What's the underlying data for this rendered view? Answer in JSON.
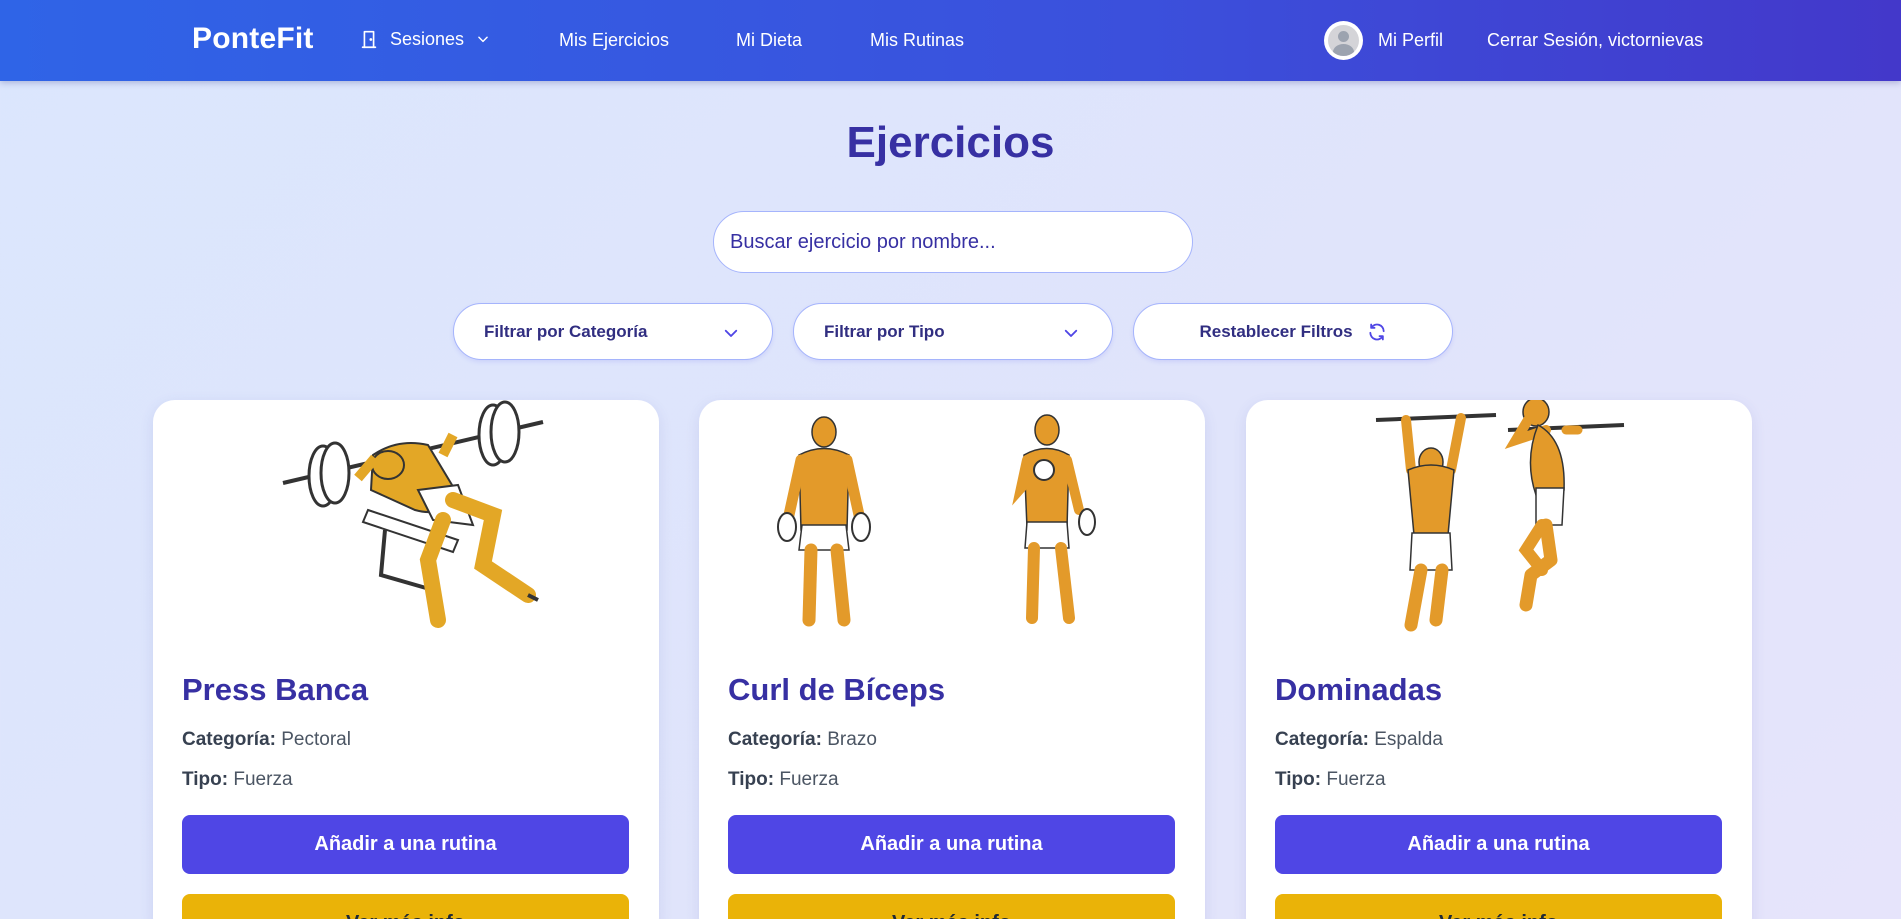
{
  "navbar": {
    "brand": "PonteFit",
    "sesiones_label": "Sesiones",
    "items": [
      {
        "label": "Mis Ejercicios"
      },
      {
        "label": "Mi Dieta"
      },
      {
        "label": "Mis Rutinas"
      }
    ],
    "perfil_label": "Mi Perfil",
    "logout_label": "Cerrar Sesión, victornievas"
  },
  "page": {
    "title": "Ejercicios"
  },
  "search": {
    "placeholder": "Buscar ejercicio por nombre...",
    "value": ""
  },
  "filters": {
    "categoria": "Filtrar por Categoría",
    "tipo": "Filtrar por Tipo",
    "reset": "Restablecer Filtros"
  },
  "labels": {
    "categoria": "Categoría:",
    "tipo": "Tipo:"
  },
  "cards": [
    {
      "name": "Press Banca",
      "categoria": "Pectoral",
      "tipo": "Fuerza",
      "add_label": "Añadir a una rutina",
      "more_label": "Ver más info"
    },
    {
      "name": "Curl de Bíceps",
      "categoria": "Brazo",
      "tipo": "Fuerza",
      "add_label": "Añadir a una rutina",
      "more_label": "Ver más info"
    },
    {
      "name": "Dominadas",
      "categoria": "Espalda",
      "tipo": "Fuerza",
      "add_label": "Añadir a una rutina",
      "more_label": "Ver más info"
    }
  ],
  "colors": {
    "nav_start": "#2f64e7",
    "nav_end": "#4338ca",
    "accent": "#4f46e5",
    "secondary": "#eab308",
    "title": "#3730a3",
    "figure_skin": "#e39a2a"
  },
  "icons": {
    "sesiones": "door-icon",
    "dropdown": "chevron-down-icon",
    "reset": "refresh-icon",
    "profile": "avatar-icon"
  }
}
